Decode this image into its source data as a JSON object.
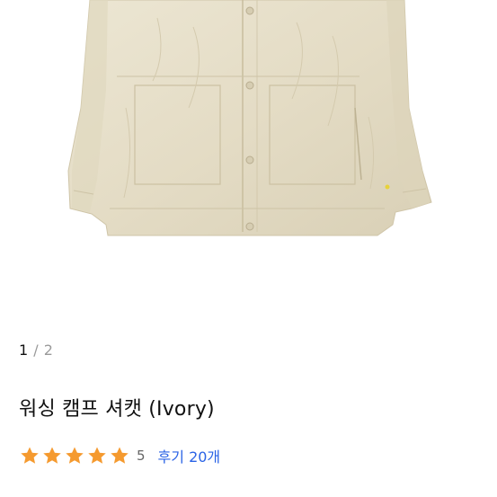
{
  "gallery": {
    "image_alt": "워싱 캠프 셔캣 (Ivory) product photo",
    "current_index": "1",
    "separator": "/",
    "total": "2"
  },
  "product": {
    "title": "워싱 캠프 셔캣 (Ivory)",
    "rating": {
      "stars": 5,
      "value": "5",
      "star_color": "#f59a2f"
    },
    "reviews_label": "후기 20개",
    "link_color": "#2a63e6"
  }
}
